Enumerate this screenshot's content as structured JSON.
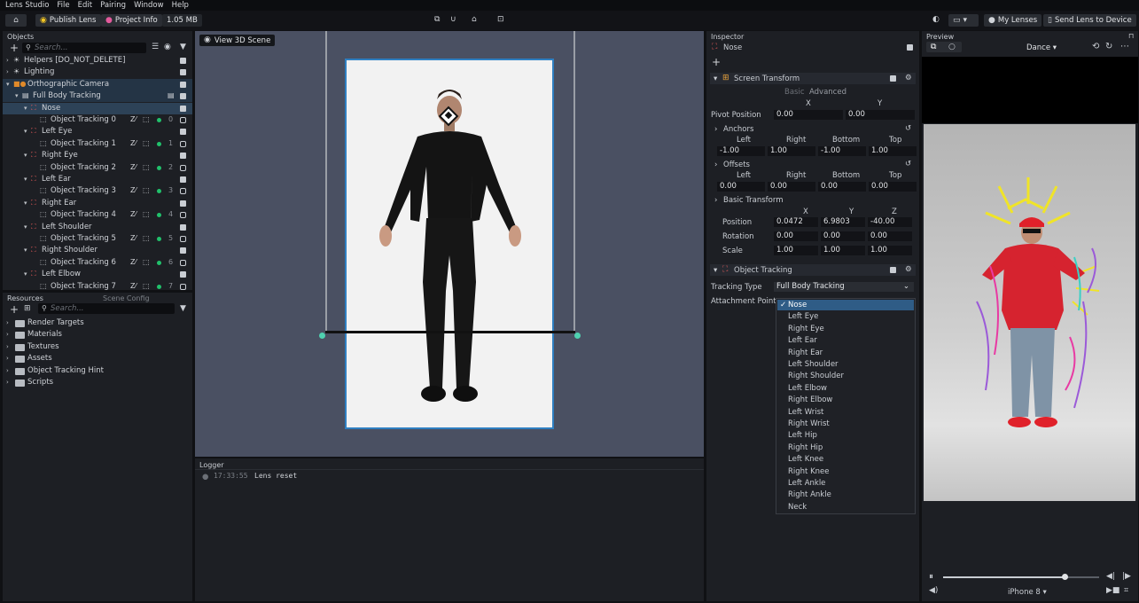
{
  "menubar": {
    "app": "Lens Studio",
    "items": [
      "File",
      "Edit",
      "Pairing",
      "Window",
      "Help"
    ]
  },
  "toolbar": {
    "publish": "Publish Lens",
    "project_info": "Project Info",
    "size": "1.05 MB",
    "my_lenses": "My Lenses",
    "send": "Send Lens to Device"
  },
  "objects": {
    "title": "Objects",
    "search_placeholder": "Search...",
    "rows": [
      {
        "label": "Helpers [DO_NOT_DELETE]",
        "checked": true
      },
      {
        "label": "Lighting",
        "checked": true
      },
      {
        "label": "Orthographic Camera",
        "checked": true
      },
      {
        "label": "Full Body Tracking",
        "checked": true
      },
      {
        "label": "Nose",
        "checked": true
      },
      {
        "label": "Object Tracking 0",
        "index": "0",
        "checked": false
      },
      {
        "label": "Left Eye",
        "checked": true
      },
      {
        "label": "Object Tracking 1",
        "index": "1",
        "checked": false
      },
      {
        "label": "Right Eye",
        "checked": true
      },
      {
        "label": "Object Tracking 2",
        "index": "2",
        "checked": false
      },
      {
        "label": "Left Ear",
        "checked": true
      },
      {
        "label": "Object Tracking 3",
        "index": "3",
        "checked": false
      },
      {
        "label": "Right Ear",
        "checked": true
      },
      {
        "label": "Object Tracking 4",
        "index": "4",
        "checked": false
      },
      {
        "label": "Left Shoulder",
        "checked": true
      },
      {
        "label": "Object Tracking 5",
        "index": "5",
        "checked": false
      },
      {
        "label": "Right Shoulder",
        "checked": true
      },
      {
        "label": "Object Tracking 6",
        "index": "6",
        "checked": false
      },
      {
        "label": "Left Elbow",
        "checked": true
      },
      {
        "label": "Object Tracking 7",
        "index": "7",
        "checked": false
      }
    ]
  },
  "resources": {
    "title": "Resources",
    "tab2": "Scene Config",
    "search_placeholder": "Search...",
    "folders": [
      "Render Targets",
      "Materials",
      "Textures",
      "Assets",
      "Object Tracking Hint",
      "Scripts"
    ]
  },
  "viewport": {
    "button": "View 3D Scene"
  },
  "logger": {
    "title": "Logger",
    "entries": [
      {
        "time": "17:33:55",
        "message": "Lens reset"
      }
    ]
  },
  "inspector": {
    "title": "Inspector",
    "object_name": "Nose",
    "screen_transform": "Screen Transform",
    "tab_basic": "Basic",
    "tab_advanced": "Advanced",
    "x_label": "X",
    "y_label": "Y",
    "z_label": "Z",
    "pivot_label": "Pivot Position",
    "pivot": [
      "0.00",
      "0.00"
    ],
    "anchors_label": "Anchors",
    "offsets_label": "Offsets",
    "cols": [
      "Left",
      "Right",
      "Bottom",
      "Top"
    ],
    "anchors": [
      "-1.00",
      "1.00",
      "-1.00",
      "1.00"
    ],
    "offsets": [
      "0.00",
      "0.00",
      "0.00",
      "0.00"
    ],
    "basic_transform": "Basic Transform",
    "position_label": "Position",
    "position": [
      "0.0472",
      "6.9803",
      "-40.00"
    ],
    "rotation_label": "Rotation",
    "rotation": [
      "0.00",
      "0.00",
      "0.00"
    ],
    "scale_label": "Scale",
    "scale": [
      "1.00",
      "1.00",
      "1.00"
    ],
    "object_tracking": "Object Tracking",
    "tracking_type_label": "Tracking Type",
    "tracking_type": "Full Body Tracking",
    "attachment_label": "Attachment Point",
    "options": [
      "Nose",
      "Left Eye",
      "Right Eye",
      "Left Ear",
      "Right Ear",
      "Left Shoulder",
      "Right Shoulder",
      "Left Elbow",
      "Right Elbow",
      "Left Wrist",
      "Right Wrist",
      "Left Hip",
      "Right Hip",
      "Left Knee",
      "Right Knee",
      "Left Ankle",
      "Right Ankle",
      "Neck"
    ],
    "selected_option": "Nose"
  },
  "preview": {
    "title": "Preview",
    "effect": "Dance",
    "device": "iPhone 8",
    "playback_progress": 0.78
  },
  "colors": {
    "accent": "#2f7fc1",
    "green": "#21c16b",
    "handle": "#4fd1b0"
  }
}
